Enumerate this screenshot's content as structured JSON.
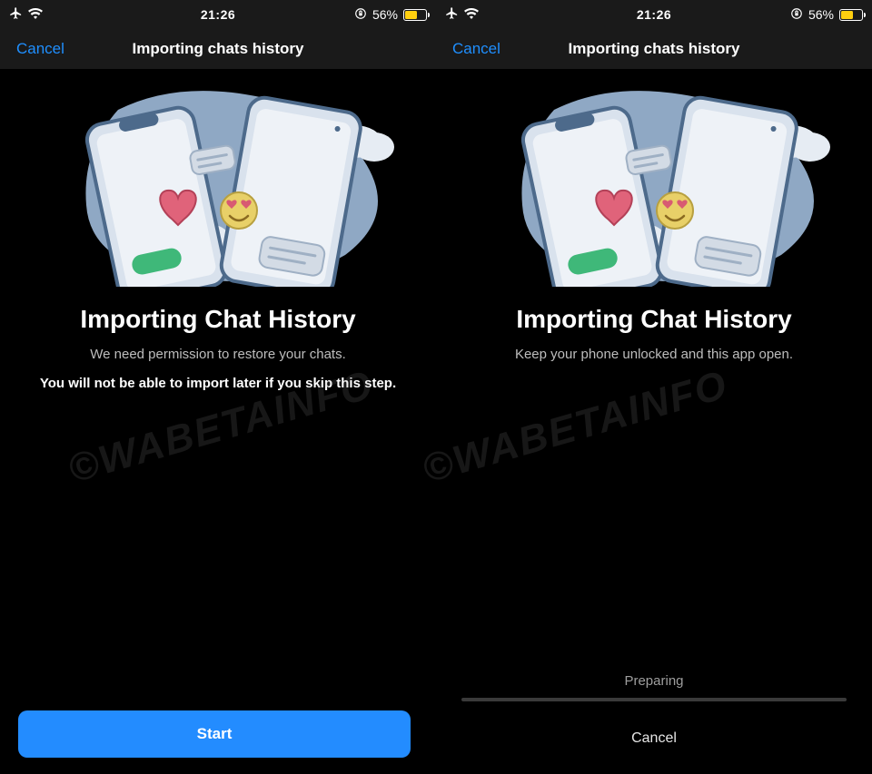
{
  "statusbar": {
    "time": "21:26",
    "battery_percent": "56%"
  },
  "navbar": {
    "cancel": "Cancel",
    "title": "Importing chats history"
  },
  "watermark": "©WABETAINFO",
  "screen1": {
    "heading": "Importing Chat History",
    "line1": "We need permission to restore your chats.",
    "line2": "You will not be able to import later if you skip this step.",
    "primary_button": "Start"
  },
  "screen2": {
    "heading": "Importing Chat History",
    "line1": "Keep your phone unlocked and this app open.",
    "progress_label": "Preparing",
    "cancel_button": "Cancel"
  }
}
